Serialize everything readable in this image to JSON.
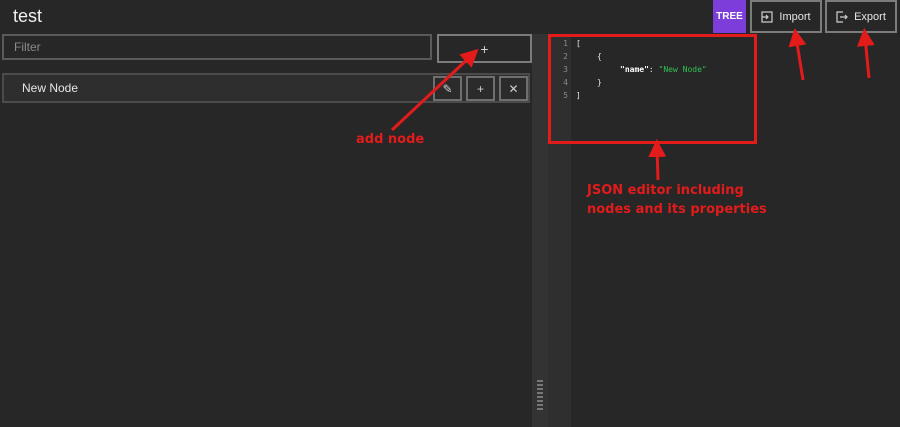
{
  "header": {
    "title": "test",
    "mode_badge": "TREE",
    "import_label": "Import",
    "export_label": "Export"
  },
  "tree_panel": {
    "filter_placeholder": "Filter",
    "add_button_glyph": "+",
    "nodes": [
      {
        "label": "New Node",
        "edit_glyph": "✎",
        "add_glyph": "+",
        "delete_glyph": "✕"
      }
    ]
  },
  "editor": {
    "line_numbers": [
      "1",
      "2",
      "3",
      "4",
      "5"
    ],
    "line1": "[",
    "line2": "{",
    "line3_key": "\"name\"",
    "line3_sep": ": ",
    "line3_value": "\"New Node\"",
    "line4": "}",
    "line5": "]"
  },
  "annotations": {
    "add_node": "add node",
    "json_line1": "JSON editor including",
    "json_line2": "nodes and its properties",
    "color": "#e31b1b"
  },
  "colors": {
    "accent": "#7d3ddb",
    "background": "#272727",
    "string": "#33c14f"
  }
}
